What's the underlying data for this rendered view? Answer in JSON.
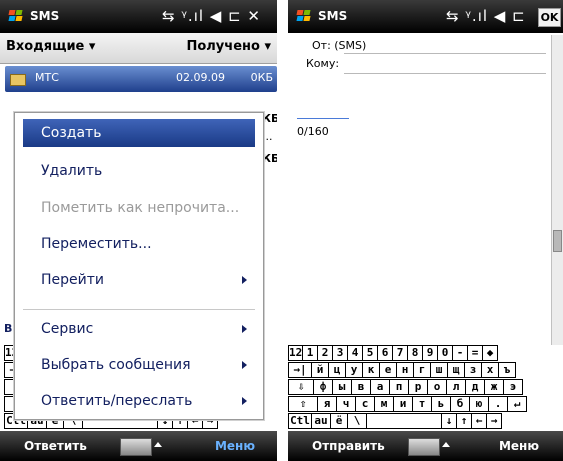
{
  "left": {
    "status": {
      "title": "SMS",
      "icons": "⇆ ᵞ.ıl ◀ ⊏ ✕"
    },
    "filter": {
      "folder": "Входящие",
      "sort": "Получено"
    },
    "message": {
      "from": "МТС",
      "date": "02.09.09",
      "size": "0КБ"
    },
    "bg_fragments": {
      "size_2": "КБ",
      "size_3": "КБ",
      "ellipsis": "...",
      "bottom_text": "Вь"
    },
    "menu": {
      "items": [
        {
          "label": "Создать",
          "selected": true,
          "disabled": false,
          "submenu": false
        },
        {
          "label": "Удалить",
          "selected": false,
          "disabled": false,
          "submenu": false
        },
        {
          "label": "Пометить как непрочита...",
          "selected": false,
          "disabled": true,
          "submenu": false
        },
        {
          "label": "Переместить...",
          "selected": false,
          "disabled": false,
          "submenu": false
        },
        {
          "label": "Перейти",
          "selected": false,
          "disabled": false,
          "submenu": true
        },
        {
          "label": "Сервис",
          "selected": false,
          "disabled": false,
          "submenu": true
        },
        {
          "label": "Выбрать сообщения",
          "selected": false,
          "disabled": false,
          "submenu": true
        },
        {
          "label": "Ответить/переслать",
          "selected": false,
          "disabled": false,
          "submenu": true
        }
      ]
    },
    "softkeys": {
      "left": "Ответить",
      "right": "Меню"
    }
  },
  "right": {
    "status": {
      "title": "SMS",
      "icons": "⇆ ᵞ.ıl ◀ ⊏",
      "ok": "OK"
    },
    "header": {
      "from_label": "От: (SMS)",
      "to_label": "Кому:"
    },
    "counter": "0/160",
    "softkeys": {
      "left": "Отправить",
      "right": "Меню"
    }
  },
  "keyboard": {
    "rows": [
      [
        "123",
        "1",
        "2",
        "3",
        "4",
        "5",
        "6",
        "7",
        "8",
        "9",
        "0",
        "-",
        "=",
        "◆"
      ],
      [
        "→|",
        "й",
        "ц",
        "у",
        "к",
        "е",
        "н",
        "г",
        "ш",
        "щ",
        "з",
        "х",
        "ъ"
      ],
      [
        "⇩",
        "ф",
        "ы",
        "в",
        "а",
        "п",
        "р",
        "о",
        "л",
        "д",
        "ж",
        "э"
      ],
      [
        "⇧",
        "я",
        "ч",
        "с",
        "м",
        "и",
        "т",
        "ь",
        "б",
        "ю",
        ".",
        "↵"
      ],
      [
        "Ctl",
        "аu",
        "ё",
        "\\",
        " ",
        "↓",
        "↑",
        "←",
        "→"
      ]
    ]
  },
  "colors": {
    "accent": "#1a3a86",
    "menu_text": "#132060",
    "disabled": "#9a9a9a"
  }
}
